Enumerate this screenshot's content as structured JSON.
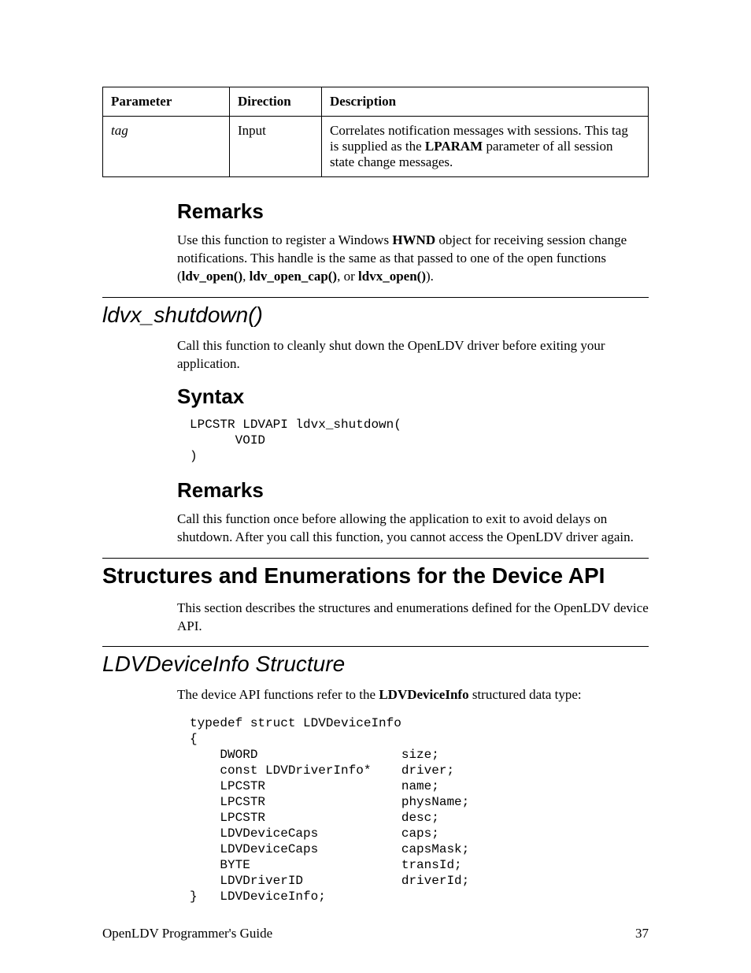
{
  "table": {
    "headers": {
      "param": "Parameter",
      "dir": "Direction",
      "desc": "Description"
    },
    "row": {
      "param": "tag",
      "dir": "Input",
      "desc_pre": "Correlates notification messages with sessions.  This tag is supplied as the ",
      "desc_bold": "LPARAM",
      "desc_post": " parameter of all session state change messages."
    }
  },
  "remarks1": {
    "heading": "Remarks",
    "p_pre": "Use this function to register a Windows ",
    "p_b1": "HWND",
    "p_mid1": " object for receiving session change notifications.  This handle is the same as that passed to one of the open functions (",
    "p_b2": "ldv_open()",
    "p_c1": ", ",
    "p_b3": "ldv_open_cap()",
    "p_c2": ", or ",
    "p_b4": "ldvx_open()",
    "p_post": ")."
  },
  "shutdown": {
    "heading": "ldvx_shutdown()",
    "intro": "Call this function to cleanly shut down the OpenLDV driver before exiting your application.",
    "syntax_h": "Syntax",
    "syntax_code": "LPCSTR LDVAPI ldvx_shutdown(\n      VOID\n)",
    "remarks_h": "Remarks",
    "remarks_p": "Call this function once before allowing the application to exit to avoid delays on shutdown.  After you call this function, you cannot access the OpenLDV driver again."
  },
  "structs": {
    "heading": "Structures and Enumerations for the Device API",
    "intro": "This section describes the structures and enumerations defined for the OpenLDV device API."
  },
  "devinfo": {
    "heading": "LDVDeviceInfo Structure",
    "intro_pre": "The device API functions refer to the ",
    "intro_b": "LDVDeviceInfo",
    "intro_post": " structured data type:",
    "code": "typedef struct LDVDeviceInfo\n{\n    DWORD                   size;\n    const LDVDriverInfo*    driver;\n    LPCSTR                  name;\n    LPCSTR                  physName;\n    LPCSTR                  desc;\n    LDVDeviceCaps           caps;\n    LDVDeviceCaps           capsMask;\n    BYTE                    transId;\n    LDVDriverID             driverId;\n}   LDVDeviceInfo;"
  },
  "footer": {
    "left": "OpenLDV Programmer's Guide",
    "right": "37"
  }
}
